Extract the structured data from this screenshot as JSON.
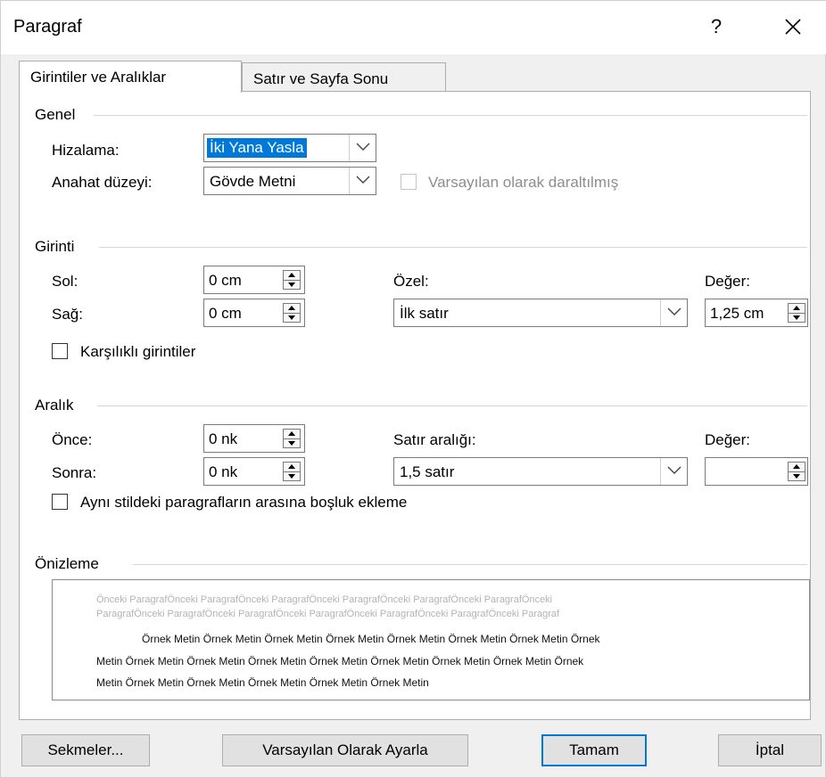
{
  "dialog": {
    "title": "Paragraf",
    "help_label": "?",
    "close_icon": "close-icon"
  },
  "tabs": [
    {
      "label": "Girintiler ve Aralıklar",
      "active": true
    },
    {
      "label": "Satır ve Sayfa Sonu",
      "active": false
    }
  ],
  "general": {
    "heading": "Genel",
    "alignment_label": "Hizalama:",
    "alignment_value": "İki Yana Yasla",
    "outline_label": "Anahat düzeyi:",
    "outline_value": "Gövde Metni",
    "collapsed_label": "Varsayılan olarak daraltılmış"
  },
  "indent": {
    "heading": "Girinti",
    "left_label": "Sol:",
    "left_value": "0 cm",
    "right_label": "Sağ:",
    "right_value": "0 cm",
    "special_label": "Özel:",
    "special_value": "İlk satır",
    "by_label": "Değer:",
    "by_value": "1,25 cm",
    "mirror_label": "Karşılıklı girintiler"
  },
  "spacing": {
    "heading": "Aralık",
    "before_label": "Önce:",
    "before_value": "0 nk",
    "after_label": "Sonra:",
    "after_value": "0 nk",
    "line_label": "Satır aralığı:",
    "line_value": "1,5 satır",
    "at_label": "Değer:",
    "at_value": "",
    "no_space_label": "Aynı stildeki paragrafların arasına boşluk ekleme"
  },
  "preview": {
    "heading": "Önizleme",
    "prev_line1": "Önceki ParagrafÖnceki ParagrafÖnceki ParagrafÖnceki ParagrafÖnceki ParagrafÖnceki ParagrafÖnceki",
    "prev_line2": "ParagrafÖnceki ParagrafÖnceki ParagrafÖnceki ParagrafÖnceki ParagrafÖnceki ParagrafÖnceki Paragraf",
    "sample_line1": "Örnek Metin Örnek Metin Örnek Metin Örnek Metin Örnek Metin Örnek Metin Örnek Metin Örnek",
    "sample_line2": "Metin Örnek Metin Örnek Metin Örnek Metin Örnek Metin Örnek Metin Örnek Metin Örnek Metin Örnek",
    "sample_line3": "Metin Örnek Metin Örnek Metin Örnek Metin Örnek Metin Örnek Metin"
  },
  "buttons": {
    "tabs": "Sekmeler...",
    "set_default": "Varsayılan Olarak Ayarla",
    "ok": "Tamam",
    "cancel": "İptal"
  }
}
